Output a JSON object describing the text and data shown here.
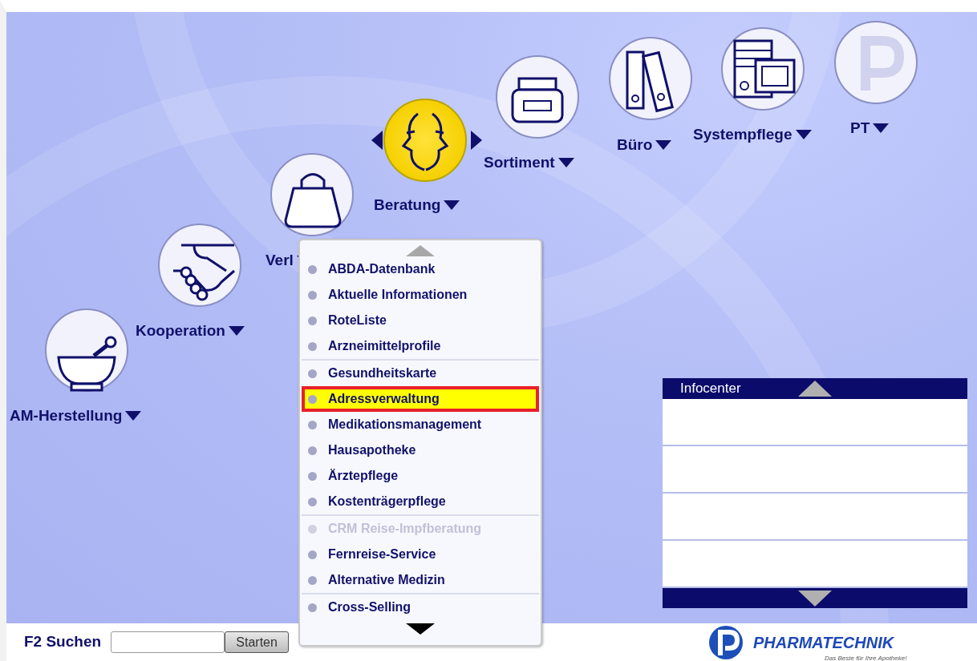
{
  "modules": [
    {
      "label": "AM-Herstellung",
      "selected": false
    },
    {
      "label": "Kooperation",
      "selected": false
    },
    {
      "label": "Verl",
      "selected": false
    },
    {
      "label": "Beratung",
      "selected": true
    },
    {
      "label": "Sortiment",
      "selected": false
    },
    {
      "label": "Büro",
      "selected": false
    },
    {
      "label": "Systempflege",
      "selected": false
    },
    {
      "label": "PT",
      "selected": false
    }
  ],
  "menu": {
    "scroll_up_enabled": false,
    "scroll_down_enabled": true,
    "groups": [
      {
        "items": [
          {
            "label": "ABDA-Datenbank",
            "selected": false,
            "disabled": false
          },
          {
            "label": "Aktuelle Informationen",
            "selected": false,
            "disabled": false
          },
          {
            "label": "RoteListe",
            "selected": false,
            "disabled": false
          },
          {
            "label": "Arzneimittelprofile",
            "selected": false,
            "disabled": false
          }
        ]
      },
      {
        "items": [
          {
            "label": "Gesundheitskarte",
            "selected": false,
            "disabled": false
          },
          {
            "label": "Adressverwaltung",
            "selected": true,
            "disabled": false
          },
          {
            "label": "Medikationsmanagement",
            "selected": false,
            "disabled": false
          },
          {
            "label": "Hausapotheke",
            "selected": false,
            "disabled": false
          },
          {
            "label": "Ärztepflege",
            "selected": false,
            "disabled": false
          },
          {
            "label": "Kostenträgerpflege",
            "selected": false,
            "disabled": false
          }
        ]
      },
      {
        "items": [
          {
            "label": "CRM Reise-Impfberatung",
            "selected": false,
            "disabled": true
          },
          {
            "label": "Fernreise-Service",
            "selected": false,
            "disabled": false
          },
          {
            "label": "Alternative Medizin",
            "selected": false,
            "disabled": false
          }
        ]
      },
      {
        "items": [
          {
            "label": "Cross-Selling",
            "selected": false,
            "disabled": false
          }
        ]
      }
    ]
  },
  "infocenter": {
    "title": "Infocenter"
  },
  "search": {
    "label": "F2 Suchen",
    "button": "Starten"
  },
  "logo": {
    "name": "PHARMATECHNIK",
    "tagline": "Das Beste für Ihre Apotheke!"
  }
}
